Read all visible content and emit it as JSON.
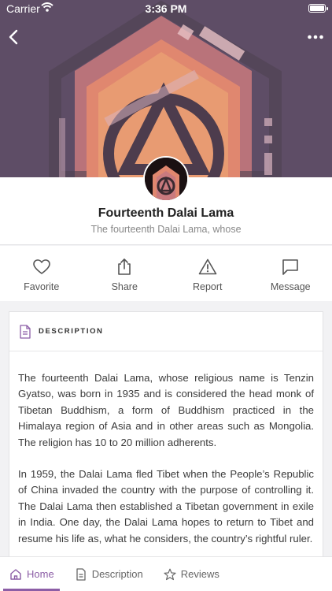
{
  "status_bar": {
    "carrier": "Carrier",
    "time": "3:36 PM"
  },
  "profile": {
    "name": "Fourteenth Dalai Lama",
    "subtitle": "The fourteenth Dalai Lama, whose"
  },
  "actions": [
    {
      "label": "Favorite",
      "icon": "heart-icon"
    },
    {
      "label": "Share",
      "icon": "share-icon"
    },
    {
      "label": "Report",
      "icon": "warning-icon"
    },
    {
      "label": "Message",
      "icon": "message-icon"
    }
  ],
  "description": {
    "title": "DESCRIPTION",
    "paragraphs": [
      "The fourteenth Dalai Lama, whose religious name is Tenzin Gyatso, was born in 1935 and is considered the head monk of Tibetan Buddhism, a form of Buddhism practiced in the Himalaya region of Asia and in other areas such as Mongolia. The religion has 10 to 20 million adherents.",
      "In 1959, the Dalai Lama fled Tibet when the People’s Republic of China invaded the country with the purpose of controlling it. The Dalai Lama then established a Tibetan government in exile in India. One day, the Dalai Lama hopes to return to Tibet and resume his life as, what he considers, the country’s rightful ruler."
    ]
  },
  "tabs": [
    {
      "label": "Home",
      "icon": "home-icon",
      "active": true
    },
    {
      "label": "Description",
      "icon": "document-icon",
      "active": false
    },
    {
      "label": "Reviews",
      "icon": "star-icon",
      "active": false
    }
  ],
  "colors": {
    "accent": "#8c5ea6",
    "hero_bg": "#5e4d66"
  }
}
